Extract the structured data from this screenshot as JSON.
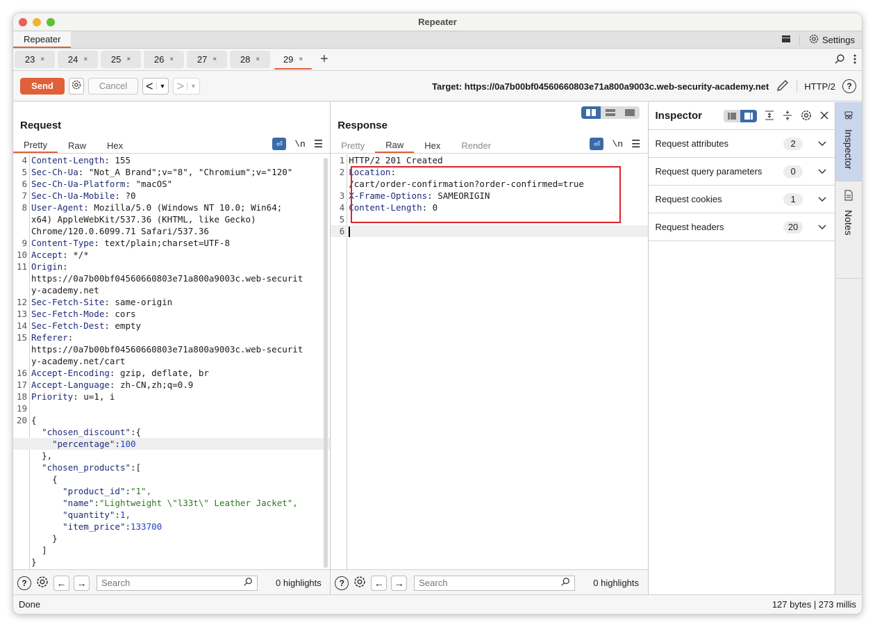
{
  "window": {
    "title": "Repeater"
  },
  "tooltabs": {
    "active": "Repeater",
    "settings_label": "Settings"
  },
  "request_tabs": [
    {
      "label": "23",
      "active": false
    },
    {
      "label": "24",
      "active": false
    },
    {
      "label": "25",
      "active": false
    },
    {
      "label": "26",
      "active": false
    },
    {
      "label": "27",
      "active": false
    },
    {
      "label": "28",
      "active": false
    },
    {
      "label": "29",
      "active": true
    }
  ],
  "toolbar": {
    "send_label": "Send",
    "cancel_label": "Cancel",
    "back_glyph": "<",
    "forward_glyph": ">",
    "target_label": "Target: https://0a7b00bf04560660803e71a800a9003c.web-security-academy.net",
    "protocol_label": "HTTP/2"
  },
  "request": {
    "title": "Request",
    "tabs": [
      "Pretty",
      "Raw",
      "Hex"
    ],
    "active_tab": "Pretty",
    "lines": [
      {
        "n": "4",
        "key": "Content-Length",
        "val": ": 155"
      },
      {
        "n": "5",
        "key": "Sec-Ch-Ua",
        "val": ": \"Not_A Brand\";v=\"8\", \"Chromium\";v=\"120\""
      },
      {
        "n": "6",
        "key": "Sec-Ch-Ua-Platform",
        "val": ": \"macOS\""
      },
      {
        "n": "7",
        "key": "Sec-Ch-Ua-Mobile",
        "val": ": ?0"
      },
      {
        "n": "8",
        "key": "User-Agent",
        "val": ": Mozilla/5.0 (Windows NT 10.0; Win64;"
      },
      {
        "n": "",
        "key": "",
        "val": "x64) AppleWebKit/537.36 (KHTML, like Gecko)"
      },
      {
        "n": "",
        "key": "",
        "val": "Chrome/120.0.6099.71 Safari/537.36"
      },
      {
        "n": "9",
        "key": "Content-Type",
        "val": ": text/plain;charset=UTF-8"
      },
      {
        "n": "10",
        "key": "Accept",
        "val": ": */*"
      },
      {
        "n": "11",
        "key": "Origin",
        "val": ":"
      },
      {
        "n": "",
        "key": "",
        "val": "https://0a7b00bf04560660803e71a800a9003c.web-securit"
      },
      {
        "n": "",
        "key": "",
        "val": "y-academy.net"
      },
      {
        "n": "12",
        "key": "Sec-Fetch-Site",
        "val": ": same-origin"
      },
      {
        "n": "13",
        "key": "Sec-Fetch-Mode",
        "val": ": cors"
      },
      {
        "n": "14",
        "key": "Sec-Fetch-Dest",
        "val": ": empty"
      },
      {
        "n": "15",
        "key": "Referer",
        "val": ":"
      },
      {
        "n": "",
        "key": "",
        "val": "https://0a7b00bf04560660803e71a800a9003c.web-securit"
      },
      {
        "n": "",
        "key": "",
        "val": "y-academy.net/cart"
      },
      {
        "n": "16",
        "key": "Accept-Encoding",
        "val": ": gzip, deflate, br"
      },
      {
        "n": "17",
        "key": "Accept-Language",
        "val": ": zh-CN,zh;q=0.9"
      },
      {
        "n": "18",
        "key": "Priority",
        "val": ": u=1, i"
      },
      {
        "n": "19",
        "key": "",
        "val": ""
      },
      {
        "n": "20",
        "key": "",
        "val": "{"
      }
    ],
    "body": [
      {
        "indent": "  ",
        "key": "\"chosen_discount\"",
        "sep": ":{",
        "val": "",
        "type": ""
      },
      {
        "indent": "    ",
        "key": "\"percentage\"",
        "sep": ":",
        "val": "100",
        "type": "n",
        "highlight": true
      },
      {
        "indent": "  ",
        "key": "",
        "sep": "},",
        "val": "",
        "type": ""
      },
      {
        "indent": "  ",
        "key": "\"chosen_products\"",
        "sep": ":[",
        "val": "",
        "type": ""
      },
      {
        "indent": "    ",
        "key": "",
        "sep": "{",
        "val": "",
        "type": ""
      },
      {
        "indent": "      ",
        "key": "\"product_id\"",
        "sep": ":",
        "val": "\"1\",",
        "type": "s"
      },
      {
        "indent": "      ",
        "key": "\"name\"",
        "sep": ":",
        "val": "\"Lightweight \\\"l33t\\\" Leather Jacket\",",
        "type": "s"
      },
      {
        "indent": "      ",
        "key": "\"quantity\"",
        "sep": ":",
        "val": "1,",
        "type": "n"
      },
      {
        "indent": "      ",
        "key": "\"item_price\"",
        "sep": ":",
        "val": "133700",
        "type": "n"
      },
      {
        "indent": "    ",
        "key": "",
        "sep": "}",
        "val": "",
        "type": ""
      },
      {
        "indent": "  ",
        "key": "",
        "sep": "]",
        "val": "",
        "type": ""
      },
      {
        "indent": "",
        "key": "",
        "sep": "}",
        "val": "",
        "type": ""
      }
    ],
    "search_placeholder": "Search",
    "highlights": "0 highlights"
  },
  "response": {
    "title": "Response",
    "tabs": [
      "Pretty",
      "Raw",
      "Hex",
      "Render"
    ],
    "active_tab": "Raw",
    "lines": [
      {
        "n": "1",
        "key": "",
        "val": "HTTP/2 201 Created"
      },
      {
        "n": "2",
        "key": "Location",
        "val": ":"
      },
      {
        "n": "",
        "key": "",
        "val": "/cart/order-confirmation?order-confirmed=true"
      },
      {
        "n": "3",
        "key": "X-Frame-Options",
        "val": ": SAMEORIGIN"
      },
      {
        "n": "4",
        "key": "Content-Length",
        "val": ": 0"
      },
      {
        "n": "5",
        "key": "",
        "val": ""
      },
      {
        "n": "6",
        "key": "",
        "val": ""
      }
    ],
    "search_placeholder": "Search",
    "highlights": "0 highlights"
  },
  "inspector": {
    "title": "Inspector",
    "rows": [
      {
        "label": "Request attributes",
        "count": "2"
      },
      {
        "label": "Request query parameters",
        "count": "0"
      },
      {
        "label": "Request cookies",
        "count": "1"
      },
      {
        "label": "Request headers",
        "count": "20"
      }
    ]
  },
  "sidebar": {
    "inspector_label": "Inspector",
    "notes_label": "Notes"
  },
  "status": {
    "left": "Done",
    "right": "127 bytes | 273 millis"
  },
  "colors": {
    "accent": "#e0603a",
    "selected_blue": "#3b6aa8",
    "highlight_box": "#d9232a"
  }
}
